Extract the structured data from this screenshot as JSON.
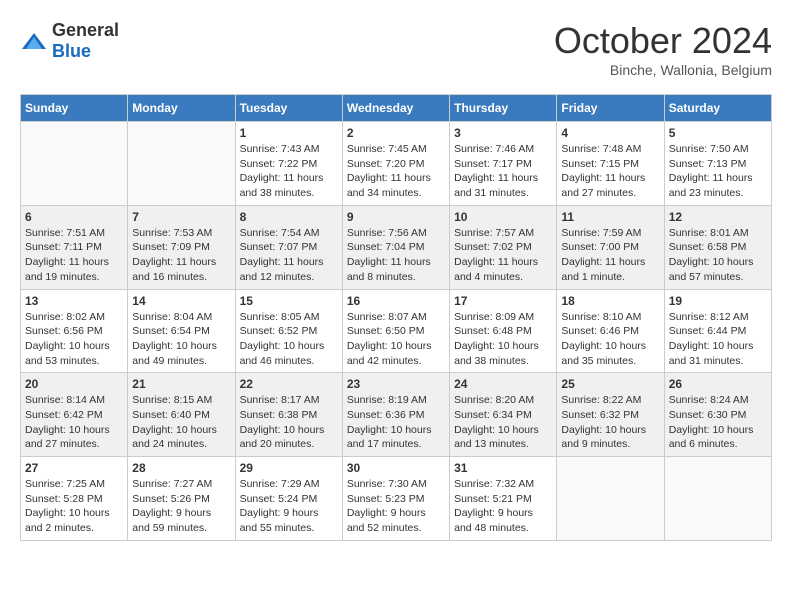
{
  "logo": {
    "general": "General",
    "blue": "Blue"
  },
  "header": {
    "month": "October 2024",
    "location": "Binche, Wallonia, Belgium"
  },
  "weekdays": [
    "Sunday",
    "Monday",
    "Tuesday",
    "Wednesday",
    "Thursday",
    "Friday",
    "Saturday"
  ],
  "weeks": [
    [
      {
        "day": "",
        "info": ""
      },
      {
        "day": "",
        "info": ""
      },
      {
        "day": "1",
        "info": "Sunrise: 7:43 AM\nSunset: 7:22 PM\nDaylight: 11 hours and 38 minutes."
      },
      {
        "day": "2",
        "info": "Sunrise: 7:45 AM\nSunset: 7:20 PM\nDaylight: 11 hours and 34 minutes."
      },
      {
        "day": "3",
        "info": "Sunrise: 7:46 AM\nSunset: 7:17 PM\nDaylight: 11 hours and 31 minutes."
      },
      {
        "day": "4",
        "info": "Sunrise: 7:48 AM\nSunset: 7:15 PM\nDaylight: 11 hours and 27 minutes."
      },
      {
        "day": "5",
        "info": "Sunrise: 7:50 AM\nSunset: 7:13 PM\nDaylight: 11 hours and 23 minutes."
      }
    ],
    [
      {
        "day": "6",
        "info": "Sunrise: 7:51 AM\nSunset: 7:11 PM\nDaylight: 11 hours and 19 minutes."
      },
      {
        "day": "7",
        "info": "Sunrise: 7:53 AM\nSunset: 7:09 PM\nDaylight: 11 hours and 16 minutes."
      },
      {
        "day": "8",
        "info": "Sunrise: 7:54 AM\nSunset: 7:07 PM\nDaylight: 11 hours and 12 minutes."
      },
      {
        "day": "9",
        "info": "Sunrise: 7:56 AM\nSunset: 7:04 PM\nDaylight: 11 hours and 8 minutes."
      },
      {
        "day": "10",
        "info": "Sunrise: 7:57 AM\nSunset: 7:02 PM\nDaylight: 11 hours and 4 minutes."
      },
      {
        "day": "11",
        "info": "Sunrise: 7:59 AM\nSunset: 7:00 PM\nDaylight: 11 hours and 1 minute."
      },
      {
        "day": "12",
        "info": "Sunrise: 8:01 AM\nSunset: 6:58 PM\nDaylight: 10 hours and 57 minutes."
      }
    ],
    [
      {
        "day": "13",
        "info": "Sunrise: 8:02 AM\nSunset: 6:56 PM\nDaylight: 10 hours and 53 minutes."
      },
      {
        "day": "14",
        "info": "Sunrise: 8:04 AM\nSunset: 6:54 PM\nDaylight: 10 hours and 49 minutes."
      },
      {
        "day": "15",
        "info": "Sunrise: 8:05 AM\nSunset: 6:52 PM\nDaylight: 10 hours and 46 minutes."
      },
      {
        "day": "16",
        "info": "Sunrise: 8:07 AM\nSunset: 6:50 PM\nDaylight: 10 hours and 42 minutes."
      },
      {
        "day": "17",
        "info": "Sunrise: 8:09 AM\nSunset: 6:48 PM\nDaylight: 10 hours and 38 minutes."
      },
      {
        "day": "18",
        "info": "Sunrise: 8:10 AM\nSunset: 6:46 PM\nDaylight: 10 hours and 35 minutes."
      },
      {
        "day": "19",
        "info": "Sunrise: 8:12 AM\nSunset: 6:44 PM\nDaylight: 10 hours and 31 minutes."
      }
    ],
    [
      {
        "day": "20",
        "info": "Sunrise: 8:14 AM\nSunset: 6:42 PM\nDaylight: 10 hours and 27 minutes."
      },
      {
        "day": "21",
        "info": "Sunrise: 8:15 AM\nSunset: 6:40 PM\nDaylight: 10 hours and 24 minutes."
      },
      {
        "day": "22",
        "info": "Sunrise: 8:17 AM\nSunset: 6:38 PM\nDaylight: 10 hours and 20 minutes."
      },
      {
        "day": "23",
        "info": "Sunrise: 8:19 AM\nSunset: 6:36 PM\nDaylight: 10 hours and 17 minutes."
      },
      {
        "day": "24",
        "info": "Sunrise: 8:20 AM\nSunset: 6:34 PM\nDaylight: 10 hours and 13 minutes."
      },
      {
        "day": "25",
        "info": "Sunrise: 8:22 AM\nSunset: 6:32 PM\nDaylight: 10 hours and 9 minutes."
      },
      {
        "day": "26",
        "info": "Sunrise: 8:24 AM\nSunset: 6:30 PM\nDaylight: 10 hours and 6 minutes."
      }
    ],
    [
      {
        "day": "27",
        "info": "Sunrise: 7:25 AM\nSunset: 5:28 PM\nDaylight: 10 hours and 2 minutes."
      },
      {
        "day": "28",
        "info": "Sunrise: 7:27 AM\nSunset: 5:26 PM\nDaylight: 9 hours and 59 minutes."
      },
      {
        "day": "29",
        "info": "Sunrise: 7:29 AM\nSunset: 5:24 PM\nDaylight: 9 hours and 55 minutes."
      },
      {
        "day": "30",
        "info": "Sunrise: 7:30 AM\nSunset: 5:23 PM\nDaylight: 9 hours and 52 minutes."
      },
      {
        "day": "31",
        "info": "Sunrise: 7:32 AM\nSunset: 5:21 PM\nDaylight: 9 hours and 48 minutes."
      },
      {
        "day": "",
        "info": ""
      },
      {
        "day": "",
        "info": ""
      }
    ]
  ]
}
